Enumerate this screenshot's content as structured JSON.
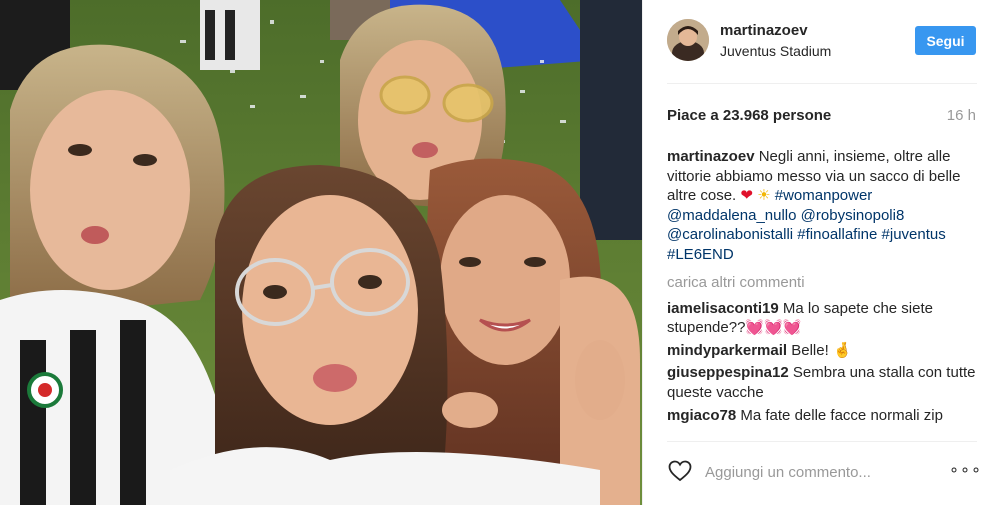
{
  "post": {
    "username": "martinazoev",
    "location": "Juventus Stadium",
    "follow_label": "Segui",
    "likes_text": "Piace a 23.968 persone",
    "time_ago": "16 h",
    "caption": {
      "author": "martinazoev",
      "text_part1": "Negli anni, insieme, oltre alle vittorie abbiamo messo via un sacco di belle altre cose.",
      "heart_emoji": "❤",
      "sun_emoji": "☀",
      "tag_womanpower": "#womanpower",
      "mention_maddalena": "@maddalena_nullo",
      "mention_roby": "@robysinopoli8",
      "mention_carolina": "@carolinabonistalli",
      "tag_finoallafine": "#finoallafine",
      "tag_juventus": "#juventus",
      "tag_le6end": "#LE6END"
    },
    "load_more_label": "carica altri commenti",
    "comments": [
      {
        "author": "iamelisaconti19",
        "text": "Ma lo sapete che siete stupende??",
        "emoji": "💓💓💓"
      },
      {
        "author": "mindyparkermail",
        "text": "Belle!",
        "emoji": "🤞"
      },
      {
        "author": "giuseppespina12",
        "text": "Sembra una stalla con tutte queste vacche",
        "emoji": ""
      },
      {
        "author": "mgiaco78",
        "text": "Ma fate delle facce normali zip",
        "emoji": ""
      }
    ],
    "add_comment_placeholder": "Aggiungi un commento...",
    "more_label": "∘∘∘"
  },
  "colors": {
    "follow_button": "#3897f0",
    "link": "#003569",
    "muted": "#999999",
    "text": "#262626"
  },
  "icons": {
    "like": "heart-outline-icon",
    "more": "ellipsis-icon"
  }
}
